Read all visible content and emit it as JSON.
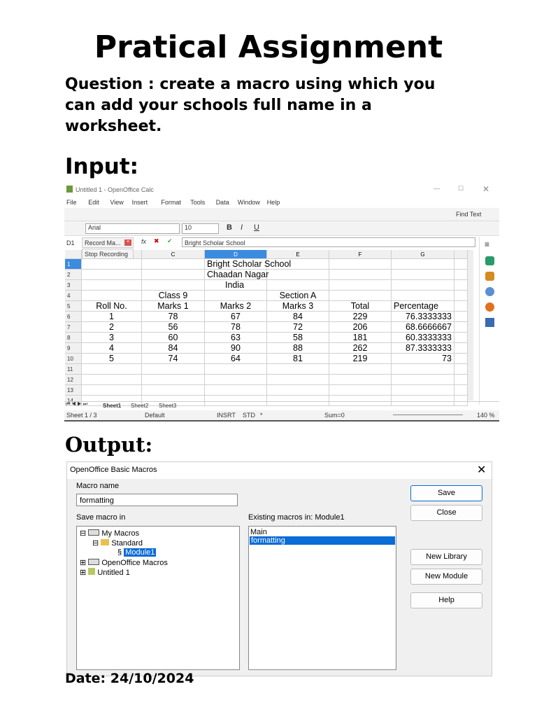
{
  "title": "Pratical Assignment",
  "question": "Question : create a macro using which you can add your schools full name in a worksheet.",
  "input_heading": "Input:",
  "output_heading": "Output:",
  "date": "Date: 24/10/2024",
  "calc": {
    "window_title": "Untitled 1 - OpenOffice Calc",
    "menu": [
      "File",
      "Edit",
      "View",
      "Insert",
      "Format",
      "Tools",
      "Data",
      "Window",
      "Help"
    ],
    "find_text": "Find Text",
    "font": "Arial",
    "size": "10",
    "cell_ref": "D1",
    "record_macro": "Record Ma...",
    "stop_recording": "Stop Recording",
    "formula": "Bright Scholar School",
    "columns": [
      "C",
      "D",
      "E",
      "F",
      "G"
    ],
    "rows": [
      [
        "",
        "",
        "Bright Scholar School",
        "",
        "",
        ""
      ],
      [
        "",
        "",
        "Chaadan Nagar",
        "",
        "",
        ""
      ],
      [
        "",
        "",
        "India",
        "",
        "",
        ""
      ],
      [
        "",
        "Class 9",
        "",
        "Section A",
        "",
        ""
      ],
      [
        "Roll No.",
        "Marks 1",
        "Marks 2",
        "Marks 3",
        "Total",
        "Percentage"
      ],
      [
        "1",
        "78",
        "67",
        "84",
        "229",
        "76.3333333"
      ],
      [
        "2",
        "56",
        "78",
        "72",
        "206",
        "68.6666667"
      ],
      [
        "3",
        "60",
        "63",
        "58",
        "181",
        "60.3333333"
      ],
      [
        "4",
        "84",
        "90",
        "88",
        "262",
        "87.3333333"
      ],
      [
        "5",
        "74",
        "64",
        "81",
        "219",
        "73"
      ],
      [
        "",
        "",
        "",
        "",
        "",
        ""
      ],
      [
        "",
        "",
        "",
        "",
        "",
        ""
      ],
      [
        "",
        "",
        "",
        "",
        "",
        ""
      ],
      [
        "",
        "",
        "",
        "",
        "",
        ""
      ]
    ],
    "sheets": [
      "Sheet1",
      "Sheet2",
      "Sheet3"
    ],
    "status": {
      "sheet": "Sheet 1 / 3",
      "style": "Default",
      "mode": "INSRT",
      "sel": "STD",
      "mod": "*",
      "sum": "Sum=0",
      "zoom": "140 %"
    }
  },
  "dialog": {
    "title": "OpenOffice Basic Macros",
    "macro_name_label": "Macro name",
    "macro_name": "formatting",
    "save_in_label": "Save macro in",
    "existing_label": "Existing macros in: Module1",
    "tree": [
      "My Macros",
      "Standard",
      "Module1",
      "OpenOffice Macros",
      "Untitled 1"
    ],
    "macros": [
      "Main",
      "formatting"
    ],
    "buttons": {
      "save": "Save",
      "close": "Close",
      "new_library": "New Library",
      "new_module": "New Module",
      "help": "Help"
    }
  }
}
